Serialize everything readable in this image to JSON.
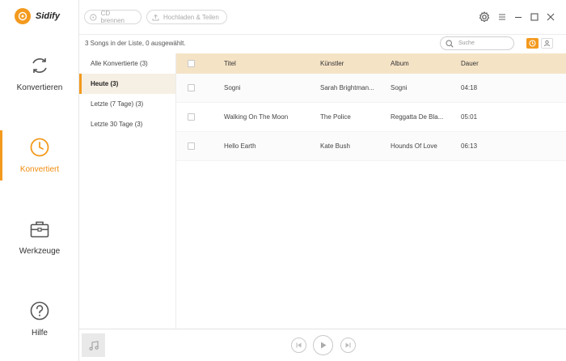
{
  "app": {
    "name": "Sidify"
  },
  "nav": [
    {
      "label": "Konvertieren",
      "icon": "refresh-icon"
    },
    {
      "label": "Konvertiert",
      "icon": "clock-icon",
      "active": true
    },
    {
      "label": "Werkzeuge",
      "icon": "toolbox-icon"
    },
    {
      "label": "Hilfe",
      "icon": "help-icon"
    }
  ],
  "toolbar": {
    "cd_label": "CD brennen",
    "upload_label": "Hochladen & Teilen"
  },
  "status_text": "3 Songs in der Liste, 0 ausgewählt.",
  "search": {
    "placeholder": "Suche"
  },
  "sublist": [
    {
      "label": "Alle Konvertierte (3)"
    },
    {
      "label": "Heute (3)",
      "active": true
    },
    {
      "label": "Letzte (7 Tage) (3)"
    },
    {
      "label": "Letzte 30 Tage (3)"
    }
  ],
  "table": {
    "headers": {
      "title": "Titel",
      "artist": "Künstler",
      "album": "Album",
      "duration": "Dauer"
    },
    "rows": [
      {
        "title": "Sogni",
        "artist": "Sarah Brightman...",
        "album": "Sogni",
        "duration": "04:18"
      },
      {
        "title": "Walking On The Moon",
        "artist": "The Police",
        "album": "Reggatta De Bla...",
        "duration": "05:01"
      },
      {
        "title": "Hello Earth",
        "artist": "Kate Bush",
        "album": "Hounds Of Love",
        "duration": "06:13"
      }
    ]
  },
  "colors": {
    "accent": "#f39a1e",
    "header_bg": "#f5e3c6",
    "active_bg": "#f6efe3"
  }
}
